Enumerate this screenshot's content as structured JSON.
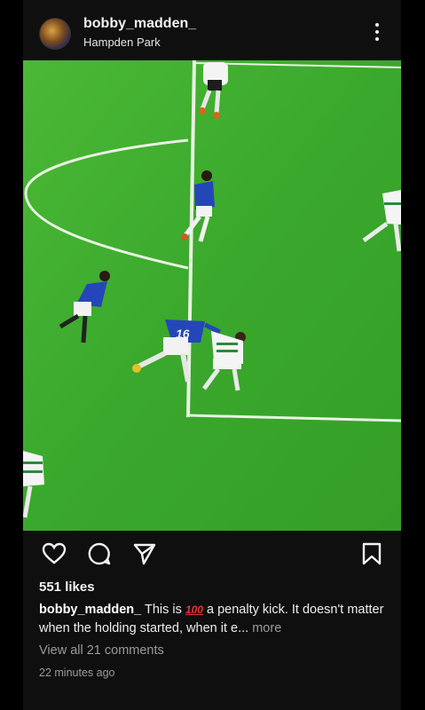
{
  "post": {
    "username": "bobby_madden_",
    "location": "Hampden Park",
    "likes": "551 likes",
    "caption_user": "bobby_madden_",
    "caption_pre": "This is",
    "caption_emoji": "100",
    "caption_text": "a penalty kick. It doesn't matter when the holding started, when it e...",
    "caption_more": "more",
    "comments_link": "View all 21 comments",
    "time": "22 minutes ago",
    "kit_number": "16"
  },
  "icons": [
    "more-vertical-icon",
    "heart-icon",
    "comment-icon",
    "share-icon",
    "bookmark-icon"
  ],
  "colors": {
    "background": "#000000",
    "pitch": "#3fae2e",
    "home_kit": "#2546b8",
    "away_kit": "#ffffff",
    "emoji_red": "#e8333b"
  }
}
